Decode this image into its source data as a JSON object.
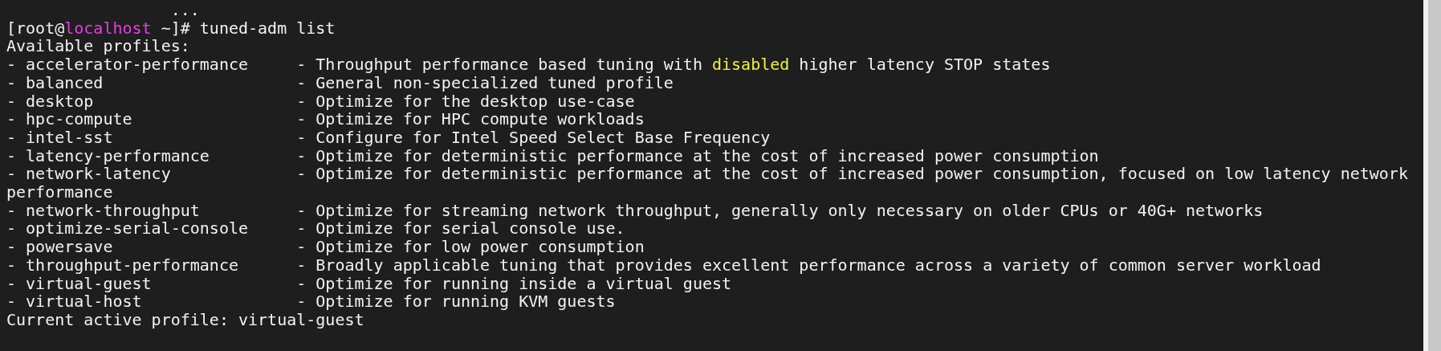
{
  "terminal": {
    "ellipsis": "...",
    "prompt": {
      "user_part": "[root@",
      "host": "localhost",
      "rest": " ~]# tuned-adm list"
    },
    "heading": "Available profiles:",
    "profiles": [
      {
        "name": "- accelerator-performance",
        "description": [
          {
            "text": "- Throughput performance based tuning with ",
            "highlight": false
          },
          {
            "text": "disabled",
            "highlight": true
          },
          {
            "text": " higher latency STOP states",
            "highlight": false
          }
        ]
      },
      {
        "name": "- balanced",
        "description": [
          {
            "text": "- General non-specialized tuned profile",
            "highlight": false
          }
        ]
      },
      {
        "name": "- desktop",
        "description": [
          {
            "text": "- Optimize for the desktop use-case",
            "highlight": false
          }
        ]
      },
      {
        "name": "- hpc-compute",
        "description": [
          {
            "text": "- Optimize for HPC compute workloads",
            "highlight": false
          }
        ]
      },
      {
        "name": "- intel-sst",
        "description": [
          {
            "text": "- Configure for Intel Speed Select Base Frequency",
            "highlight": false
          }
        ]
      },
      {
        "name": "- latency-performance",
        "description": [
          {
            "text": "- Optimize for deterministic performance at the cost of increased power consumption",
            "highlight": false
          }
        ]
      },
      {
        "name": "- network-latency",
        "description": [
          {
            "text": "- Optimize for deterministic performance at the cost of increased power consumption, focused on low latency network",
            "highlight": false
          }
        ],
        "continuation": "performance"
      },
      {
        "name": "- network-throughput",
        "description": [
          {
            "text": "- Optimize for streaming network throughput, generally only necessary on older CPUs or 40G+ networks",
            "highlight": false
          }
        ]
      },
      {
        "name": "- optimize-serial-console",
        "description": [
          {
            "text": "- Optimize for serial console use.",
            "highlight": false
          }
        ]
      },
      {
        "name": "- powersave",
        "description": [
          {
            "text": "- Optimize for low power consumption",
            "highlight": false
          }
        ]
      },
      {
        "name": "- throughput-performance",
        "description": [
          {
            "text": "- Broadly applicable tuning that provides excellent performance across a variety of common server workload",
            "highlight": false
          }
        ]
      },
      {
        "name": "- virtual-guest",
        "description": [
          {
            "text": "- Optimize for running inside a virtual guest",
            "highlight": false
          }
        ]
      },
      {
        "name": "- virtual-host",
        "description": [
          {
            "text": "- Optimize for running KVM guests",
            "highlight": false
          }
        ]
      }
    ],
    "active_profile": "Current active profile: virtual-guest"
  }
}
